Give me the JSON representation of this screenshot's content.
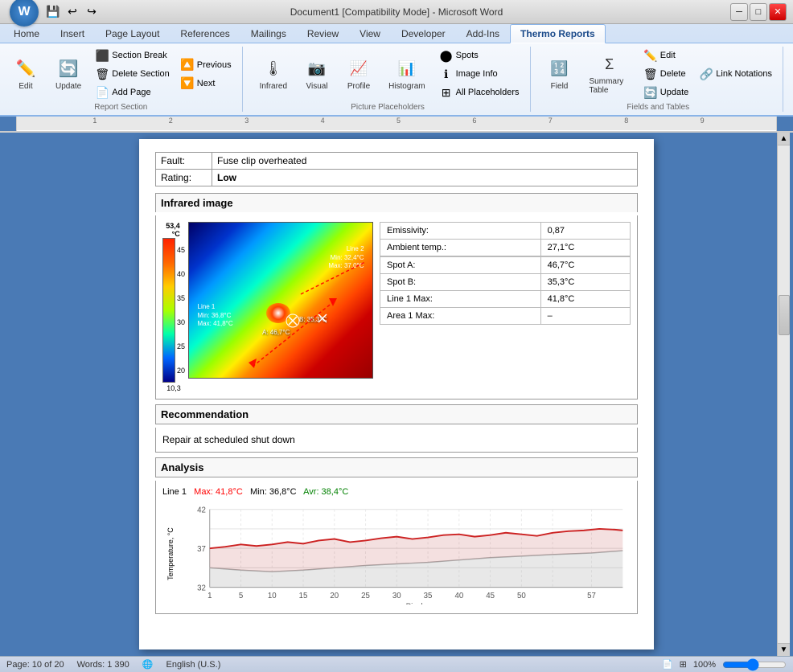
{
  "titleBar": {
    "title": "Document1 [Compatibility Mode] - Microsoft Word",
    "minimizeLabel": "─",
    "maximizeLabel": "□",
    "closeLabel": "✕"
  },
  "ribbon": {
    "tabs": [
      {
        "label": "Home",
        "active": false
      },
      {
        "label": "Insert",
        "active": false
      },
      {
        "label": "Page Layout",
        "active": false
      },
      {
        "label": "References",
        "active": false
      },
      {
        "label": "Mailings",
        "active": false
      },
      {
        "label": "Review",
        "active": false
      },
      {
        "label": "View",
        "active": false
      },
      {
        "label": "Developer",
        "active": false
      },
      {
        "label": "Add-Ins",
        "active": false
      },
      {
        "label": "Thermo Reports",
        "active": true
      }
    ],
    "groups": {
      "reportSection": {
        "label": "Report Section",
        "editLabel": "Edit",
        "updateLabel": "Update",
        "sectionBreakLabel": "Section Break",
        "deleteSectionLabel": "Delete Section",
        "addPageLabel": "Add Page",
        "previousLabel": "Previous",
        "nextLabel": "Next"
      },
      "picturePlaceholders": {
        "label": "Picture Placeholders",
        "infraredLabel": "Infrared",
        "visualLabel": "Visual",
        "profileLabel": "Profile",
        "histogramLabel": "Histogram",
        "spotsLabel": "Spots",
        "imageInfoLabel": "Image Info",
        "allPlaceholdersLabel": "All Placeholders"
      },
      "fieldsAndTables": {
        "label": "Fields and Tables",
        "fieldLabel": "Field",
        "summaryTableLabel": "Summary Table",
        "editLabel": "Edit",
        "deleteLabel": "Delete",
        "updateLabel": "Update",
        "linkNotationsLabel": "Link Notations"
      }
    }
  },
  "document": {
    "fault": {
      "label": "Fault:",
      "value": "Fuse clip overheated"
    },
    "rating": {
      "label": "Rating:",
      "value": "Low"
    },
    "sections": {
      "infraredImage": {
        "heading": "Infrared image",
        "colorbarMax": "53,4",
        "colorbarUnit": "°C",
        "colorbarValues": [
          "45",
          "40",
          "35",
          "30",
          "25",
          "20"
        ],
        "colorbarMin": "10,3",
        "annotations": {
          "line1": "Line 1",
          "line1Min": "Min: 36,8°C",
          "line1Max": "Max: 41,8°C",
          "line2": "Line 2",
          "line2Min": "Min: 32,4°C",
          "line2Max": "Max: 37,0°C",
          "spotA": "A: 46,7°C",
          "spotB": "B: 35,3°C"
        },
        "measurements": [
          {
            "label": "Emissivity:",
            "value": "0,87"
          },
          {
            "label": "Ambient temp.:",
            "value": "27,1°C"
          },
          {
            "label": "Spot A:",
            "value": "46,7°C"
          },
          {
            "label": "Spot B:",
            "value": "35,3°C"
          },
          {
            "label": "Line 1 Max:",
            "value": "41,8°C"
          },
          {
            "label": "Area 1 Max:",
            "value": "–"
          }
        ]
      },
      "recommendation": {
        "heading": "Recommendation",
        "text": "Repair at scheduled shut down"
      },
      "analysis": {
        "heading": "Analysis",
        "chartTitle": "Line 1",
        "maxLabel": "Max: 41,8°C",
        "minLabel": "Min: 36,8°C",
        "avrLabel": "Avr: 38,4°C",
        "yAxisMax": "42",
        "yAxisMin": "32",
        "yAxisLabel": "Temperature, °C",
        "xAxisLabel": "Pixels",
        "xAxisValues": [
          "1",
          "5",
          "10",
          "15",
          "20",
          "25",
          "30",
          "35",
          "40",
          "45",
          "50",
          "57"
        ]
      }
    }
  },
  "statusBar": {
    "page": "Page: 10 of 20",
    "words": "Words: 1 390",
    "language": "English (U.S.)",
    "zoom": "100%"
  }
}
